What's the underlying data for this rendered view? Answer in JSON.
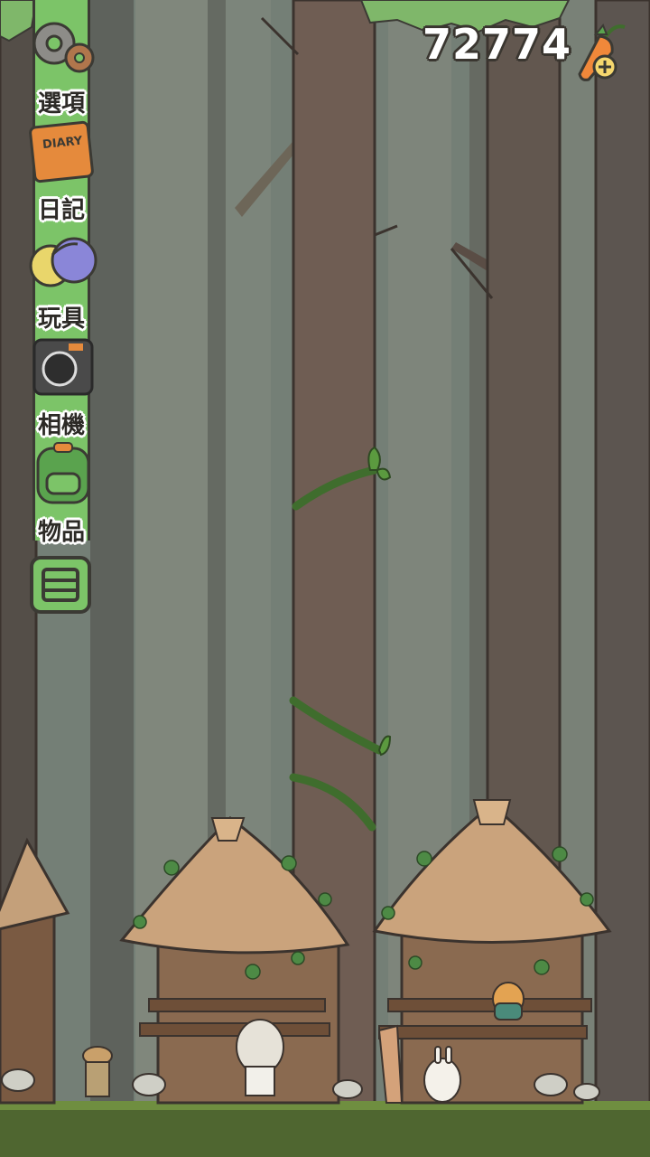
{
  "hud": {
    "carrot_count": "72774",
    "menu": [
      {
        "id": "options",
        "label": "選項",
        "icon": "gear-icon"
      },
      {
        "id": "diary",
        "label": "日記",
        "icon": "diary-book-icon",
        "icon_text": "DIARY"
      },
      {
        "id": "toys",
        "label": "玩具",
        "icon": "toy-balls-icon"
      },
      {
        "id": "camera",
        "label": "相機",
        "icon": "camera-icon"
      },
      {
        "id": "items",
        "label": "物品",
        "icon": "backpack-icon"
      }
    ],
    "toggle_icon": "menu-list-icon",
    "add_icon": "carrot-plus-icon"
  },
  "colors": {
    "rail_green": "#7cc468",
    "forest_bg": "#6b7870",
    "trunk": "#6e5b51",
    "grass": "#5f7d3a",
    "carrot_orange": "#f0883a"
  }
}
